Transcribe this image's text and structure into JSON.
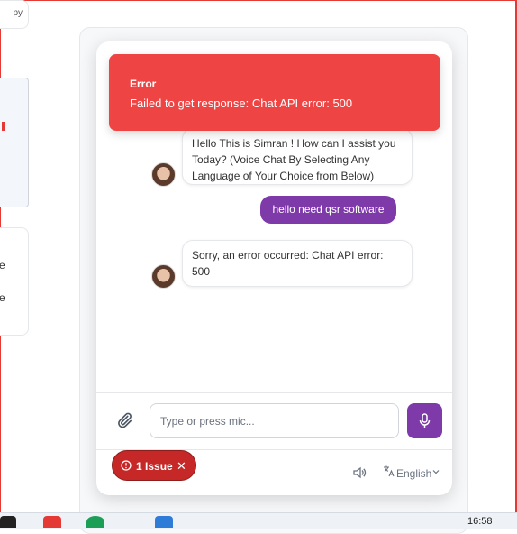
{
  "background": {
    "card1_text": "py",
    "card2_lines": [
      "e",
      "e"
    ]
  },
  "toast": {
    "title": "Error",
    "message": "Failed to get response: Chat API error: 500"
  },
  "messages": [
    {
      "role": "bot",
      "text": "Hello This is Simran ! How can I assist you Today? (Voice Chat By Selecting Any Language of Your Choice from Below)"
    },
    {
      "role": "user",
      "text": "hello need qsr software"
    },
    {
      "role": "bot",
      "text": "Sorry, an error occurred: Chat API error: 500"
    }
  ],
  "input": {
    "placeholder": "Type or press mic..."
  },
  "footer": {
    "language": "English",
    "speaker_icon": "speaker-icon",
    "translate_icon": "translate-icon"
  },
  "issue_badge": {
    "label": "1 Issue"
  },
  "taskbar": {
    "time": "16:58"
  },
  "colors": {
    "accent": "#7e3aa8",
    "error": "#ef4444",
    "issue": "#c62828"
  }
}
